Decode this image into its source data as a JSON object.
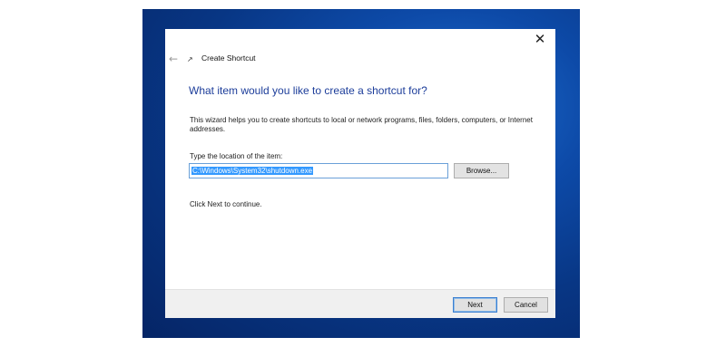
{
  "window": {
    "title": "Create Shortcut",
    "close_glyph": "✕",
    "back_glyph": "←",
    "app_icon": "shortcut-arrow-icon",
    "app_icon_glyph": "↗"
  },
  "main": {
    "heading": "What item would you like to create a shortcut for?",
    "description": "This wizard helps you to create shortcuts to local or network programs, files, folders, computers, or Internet addresses.",
    "location_label": "Type the location of the item:",
    "location_value": "C:\\Windows\\System32\\shutdown.exe",
    "browse_label": "Browse...",
    "continue_hint": "Click Next to continue."
  },
  "footer": {
    "next_label": "Next",
    "cancel_label": "Cancel"
  },
  "colors": {
    "heading": "#1c3d9a",
    "selection": "#3399ff",
    "desktop": "#0d4aa8"
  }
}
